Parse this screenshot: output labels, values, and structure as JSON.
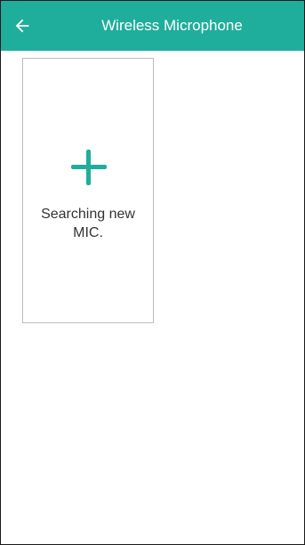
{
  "app_bar": {
    "title": "Wireless Microphone",
    "back_icon": "arrow-left-icon",
    "color": "#1fae9b"
  },
  "card": {
    "icon": "plus-icon",
    "label": "Searching new MIC.",
    "accent_color": "#1fae9b"
  }
}
